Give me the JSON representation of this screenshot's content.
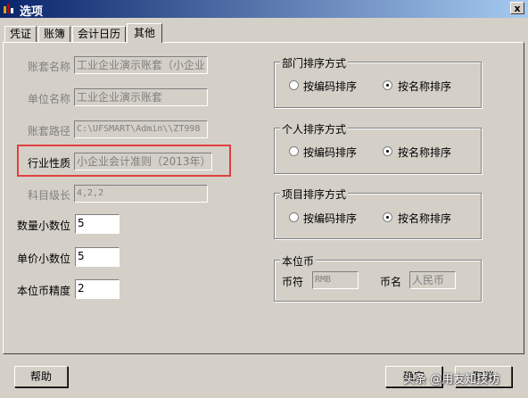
{
  "window": {
    "title": "选项",
    "close_glyph": "x"
  },
  "tabs": [
    {
      "label": "凭证"
    },
    {
      "label": "账簿"
    },
    {
      "label": "会计日历"
    },
    {
      "label": "其他"
    }
  ],
  "fields": {
    "account_set_name": {
      "label": "账套名称",
      "value": "工业企业演示账套（小企业"
    },
    "unit_name": {
      "label": "单位名称",
      "value": "工业企业演示账套"
    },
    "account_path": {
      "label": "账套路径",
      "value": "C:\\UFSMART\\Admin\\\\ZT998"
    },
    "industry_type": {
      "label": "行业性质",
      "value": "小企业会计准则（2013年）"
    },
    "subject_levels": {
      "label": "科目级长",
      "value": "4,2,2"
    },
    "qty_decimals": {
      "label": "数量小数位",
      "value": "5"
    },
    "price_decimals": {
      "label": "单价小数位",
      "value": "5"
    },
    "currency_precision": {
      "label": "本位币精度",
      "value": "2"
    }
  },
  "groups": {
    "dept_sort": {
      "title": "部门排序方式",
      "opt_code": "按编码排序",
      "opt_name": "按名称排序",
      "selected": "name"
    },
    "person_sort": {
      "title": "个人排序方式",
      "opt_code": "按编码排序",
      "opt_name": "按名称排序",
      "selected": "name"
    },
    "project_sort": {
      "title": "项目排序方式",
      "opt_code": "按编码排序",
      "opt_name": "按名称排序",
      "selected": "name"
    },
    "base_currency": {
      "title": "本位币",
      "code_label": "币符",
      "code_value": "RMB",
      "name_label": "币名",
      "name_value": "人民币"
    }
  },
  "buttons": {
    "help": "帮助",
    "ok": "确定",
    "cancel": "取消"
  },
  "watermark": "头条 @用友知技坊"
}
